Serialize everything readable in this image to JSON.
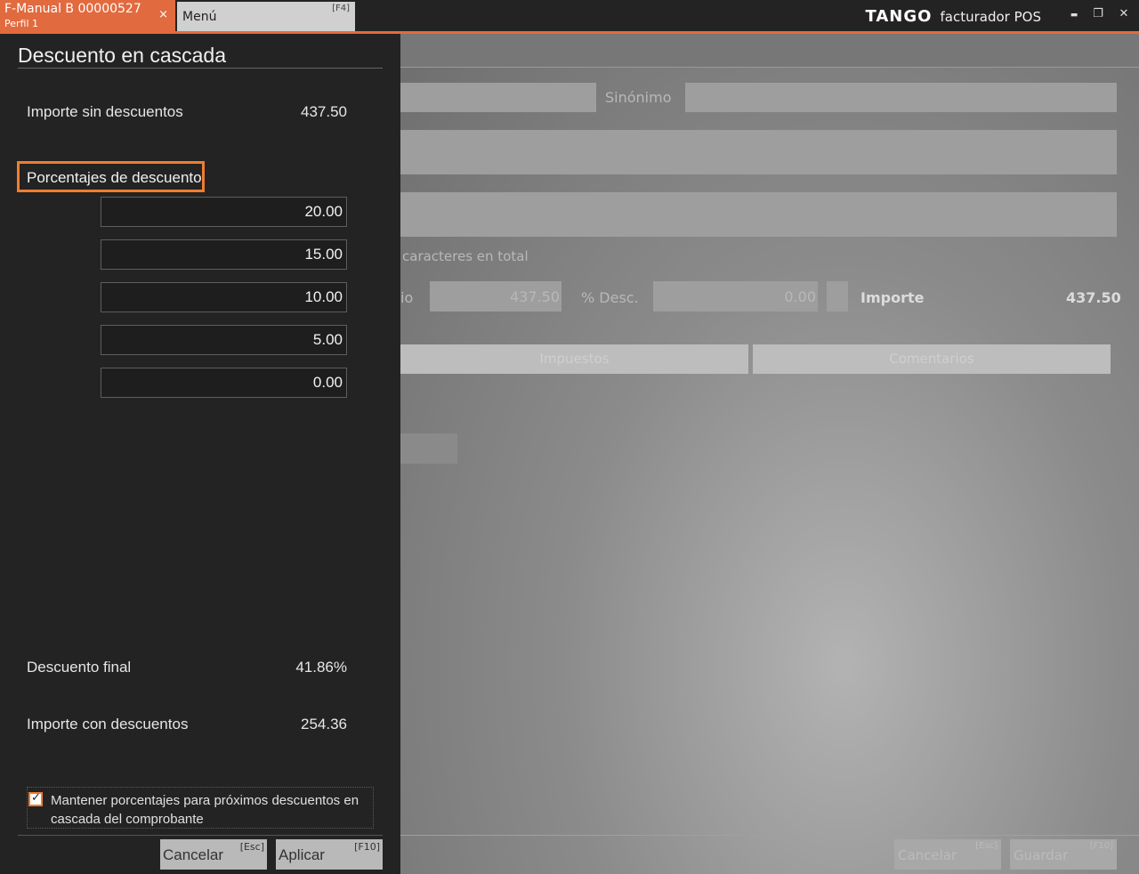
{
  "topbar": {
    "doc_tab_title": "F-Manual B 00000527",
    "doc_tab_subtitle": "Perfil 1",
    "doc_tab_close": "×",
    "menu_label": "Menú",
    "menu_key": "[F4]",
    "brand_name": "TANGO",
    "brand_product": "facturador POS",
    "minimize": "▬",
    "restore": "❐",
    "close": "✕"
  },
  "background_form": {
    "synonym_label": "Sinónimo",
    "chars_text": "caracteres en total",
    "price_label_partial": "io",
    "price_value": "437.50",
    "desc_label": "% Desc.",
    "desc_value": "0.00",
    "importe_label": "Importe",
    "importe_value": "437.50",
    "tab_taxes": "Impuestos",
    "tab_comments": "Comentarios",
    "cancel_label": "Cancelar",
    "cancel_key": "[Esc]",
    "save_label": "Guardar",
    "save_key": "[F10]"
  },
  "panel": {
    "title": "Descuento en cascada",
    "importe_sin_label": "Importe sin descuentos",
    "importe_sin_value": "437.50",
    "section_label": "Porcentajes de descuento",
    "percentages": [
      "20.00",
      "15.00",
      "10.00",
      "5.00",
      "0.00"
    ],
    "descuento_final_label": "Descuento final",
    "descuento_final_value": "41.86%",
    "importe_con_label": "Importe con descuentos",
    "importe_con_value": "254.36",
    "keep_checkbox_label": "Mantener porcentajes para próximos descuentos en cascada del comprobante",
    "keep_checked": true,
    "cancel_label": "Cancelar",
    "cancel_key": "[Esc]",
    "apply_label": "Aplicar",
    "apply_key": "[F10]"
  },
  "colors": {
    "accent": "#f07d2e",
    "tab_orange": "#e26a3f",
    "panel_bg": "#232323"
  }
}
